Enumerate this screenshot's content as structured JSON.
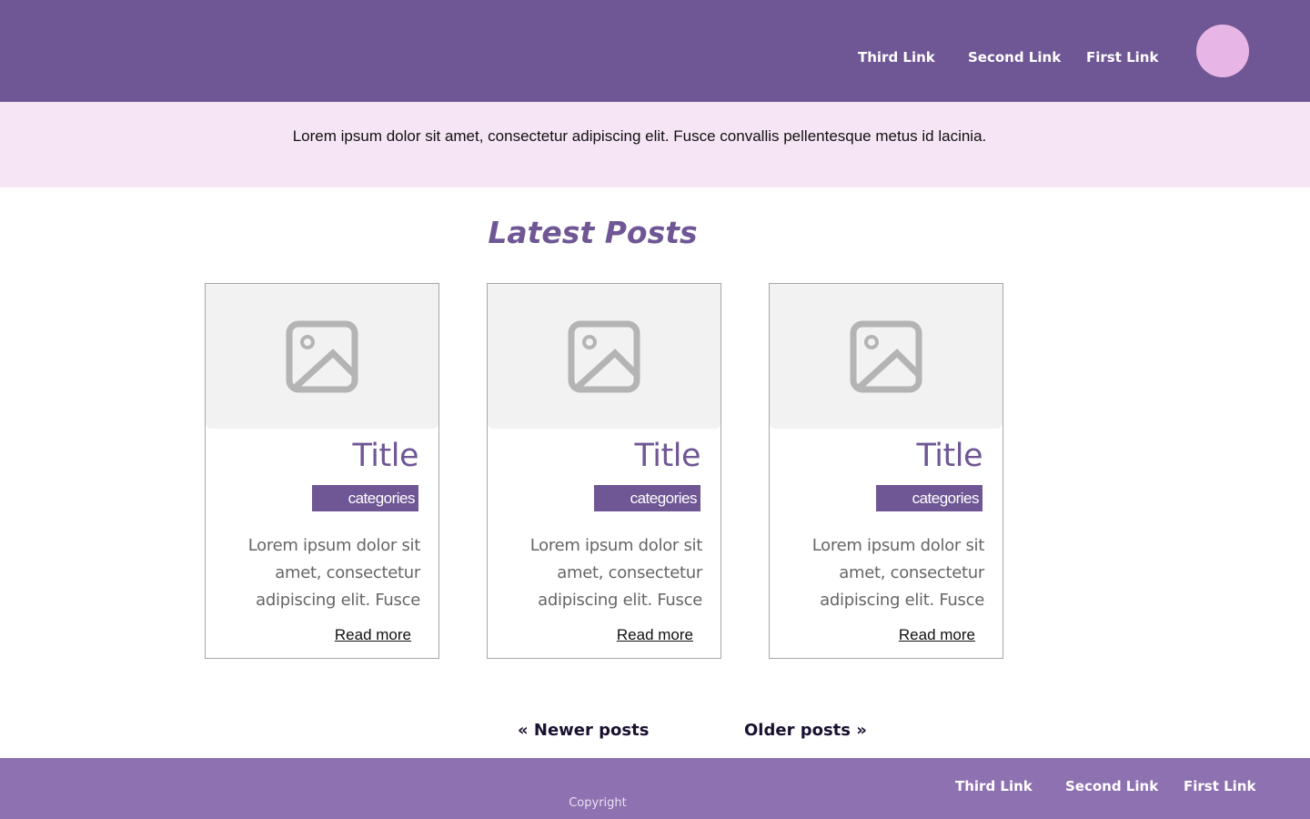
{
  "header": {
    "nav": [
      {
        "label": "Third Link"
      },
      {
        "label": "Second Link"
      },
      {
        "label": "First Link"
      }
    ]
  },
  "banner": {
    "text": "Lorem ipsum dolor sit amet, consectetur adipiscing elit. Fusce convallis pellentesque metus id lacinia."
  },
  "main": {
    "title": "Latest Posts",
    "posts": [
      {
        "title": "Title",
        "category": "categories",
        "excerpt": "Lorem ipsum dolor sit amet, consectetur adipiscing elit. Fusce",
        "read_more": "Read more",
        "image_icon": "image-placeholder-icon"
      },
      {
        "title": "Title",
        "category": "categories",
        "excerpt": "Lorem ipsum dolor sit amet, consectetur adipiscing elit. Fusce",
        "read_more": "Read more",
        "image_icon": "image-placeholder-icon"
      },
      {
        "title": "Title",
        "category": "categories",
        "excerpt": "Lorem ipsum dolor sit amet, consectetur adipiscing elit. Fusce",
        "read_more": "Read more",
        "image_icon": "image-placeholder-icon"
      }
    ]
  },
  "pagination": {
    "newer": "« Newer posts",
    "older": "Older posts »"
  },
  "footer": {
    "nav": [
      {
        "label": "Third Link"
      },
      {
        "label": "Second Link"
      },
      {
        "label": "First Link"
      }
    ],
    "copyright": "Copyright"
  },
  "colors": {
    "primary": "#6f5795",
    "footer": "#8e71b0",
    "banner_bg": "#f6e6f5",
    "avatar": "#e8b6e6"
  }
}
